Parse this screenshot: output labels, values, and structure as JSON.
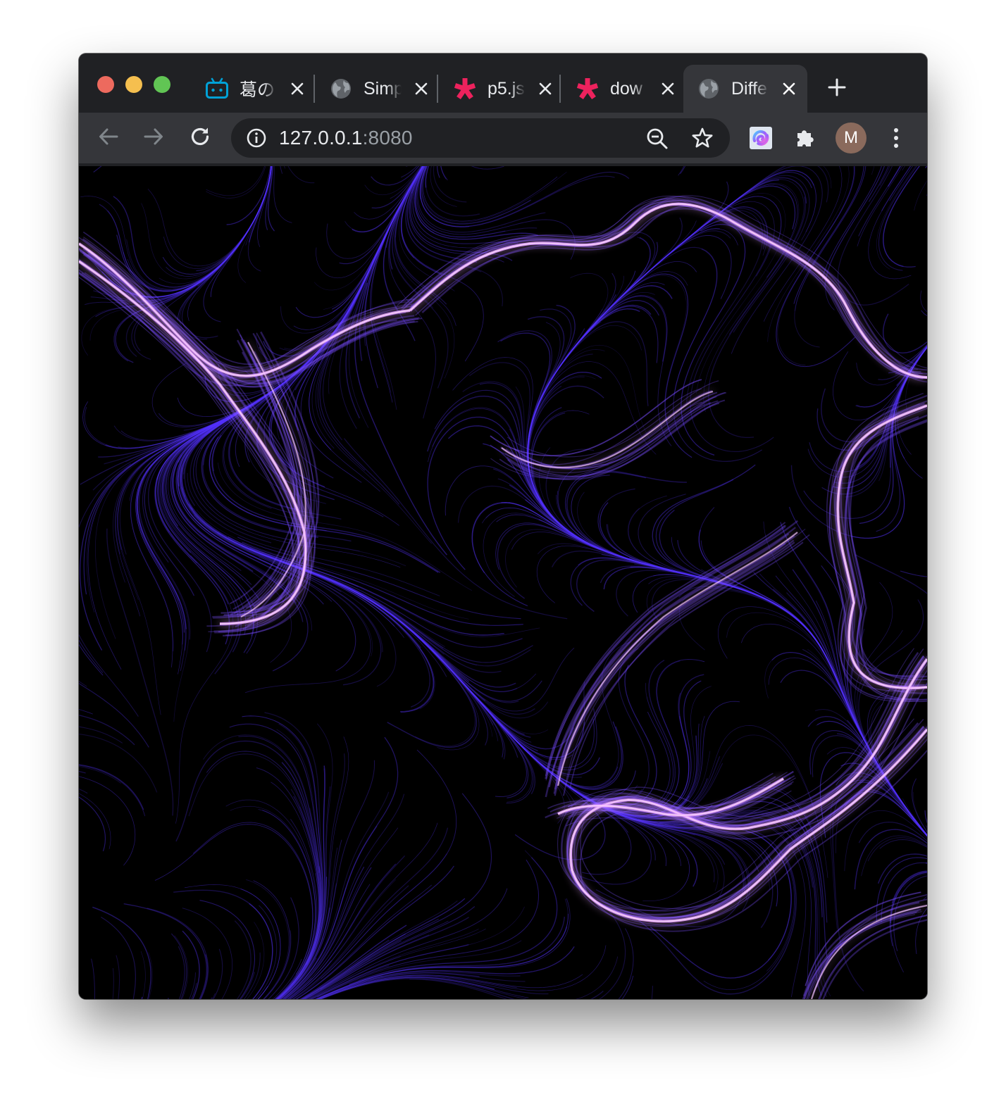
{
  "window": {
    "tabs": [
      {
        "title": "葛の",
        "favicon": "bilibili-tv-icon",
        "color": "#00a1d6"
      },
      {
        "title": "Simp",
        "favicon": "globe-icon",
        "color": "#9aa0a6"
      },
      {
        "title": "p5.js",
        "favicon": "p5-asterisk-icon",
        "color": "#ed225d"
      },
      {
        "title": "dow",
        "favicon": "p5-asterisk-icon",
        "color": "#ed225d"
      },
      {
        "title": "Diffe",
        "favicon": "globe-icon",
        "color": "#9aa0a6",
        "active": true
      }
    ],
    "new_tab_icon": "plus-icon"
  },
  "toolbar": {
    "back_icon": "arrow-left-icon",
    "forward_icon": "arrow-right-icon",
    "reload_icon": "reload-icon",
    "site_info_icon": "info-icon",
    "url_host": "127.0.0.1",
    "url_port": ":8080",
    "zoom_icon": "zoom-out-icon",
    "bookmark_icon": "star-outline-icon",
    "extensions": [
      "gradient-swirl-extension-icon",
      "puzzle-piece-icon"
    ],
    "profile_initial": "M",
    "menu_icon": "kebab-menu-icon"
  },
  "canvas": {
    "background": "#000000",
    "line_color": "#5533ff",
    "highlight_color": "#e9a3ff",
    "description_icon": "flow-field-artwork"
  }
}
